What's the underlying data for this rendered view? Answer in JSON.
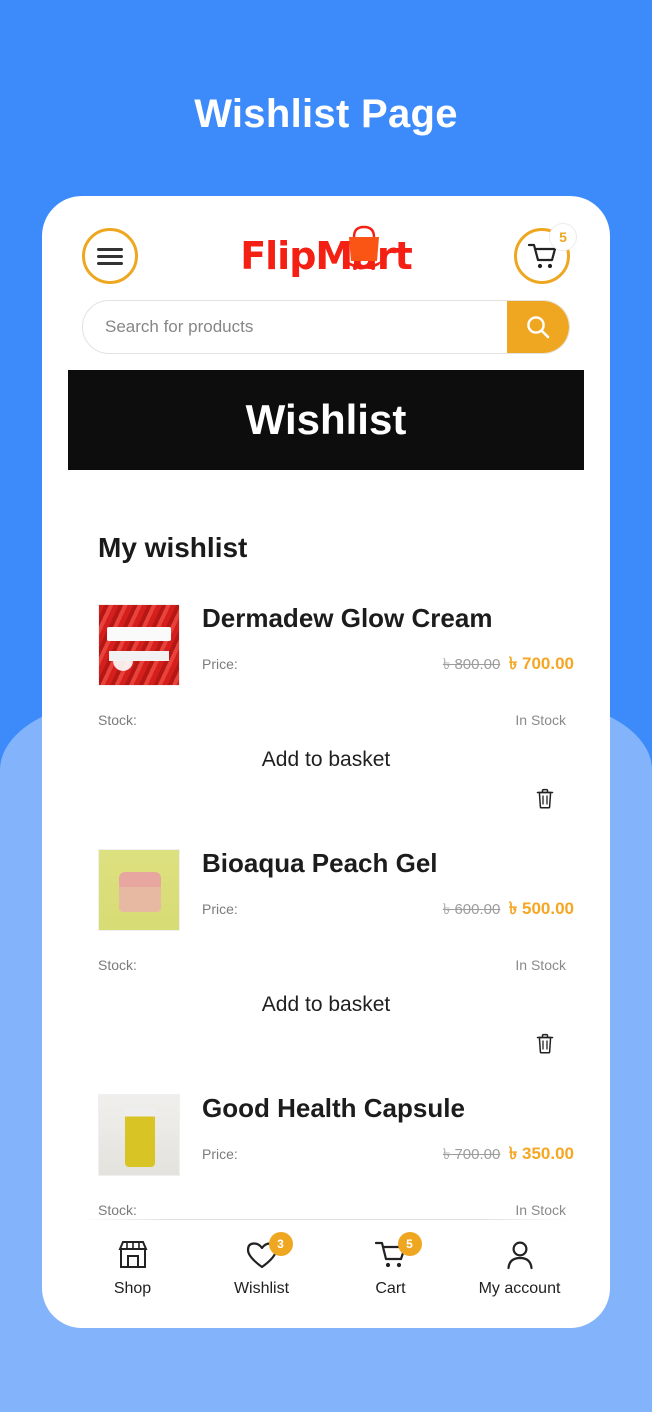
{
  "page": {
    "title": "Wishlist Page",
    "background_color": "#3d8bfa",
    "background_lower_color": "#83b4fb",
    "accent_color": "#efa721",
    "price_color": "#f5a623",
    "logo_color": "#f32013"
  },
  "header": {
    "menu_icon": "hamburger-icon",
    "logo_text": "FlipMart",
    "logo_icon": "shopping-bag-icon",
    "cart_icon": "cart-icon",
    "cart_badge": "5"
  },
  "search": {
    "placeholder": "Search for products",
    "value": "",
    "button_icon": "search-icon"
  },
  "banner": {
    "title": "Wishlist"
  },
  "main": {
    "section_title": "My wishlist",
    "price_label": "Price:",
    "stock_label": "Stock:",
    "add_to_basket_label": "Add to basket",
    "remove_icon": "trash-icon",
    "currency": "৳",
    "items": [
      {
        "name": "Dermadew Glow Cream",
        "old_price": "৳ 800.00",
        "new_price": "৳ 700.00",
        "stock": "In Stock",
        "thumb_alt": "dermadew-glow-cream-thumbnail"
      },
      {
        "name": "Bioaqua Peach Gel",
        "old_price": "৳ 600.00",
        "new_price": "৳ 500.00",
        "stock": "In Stock",
        "thumb_alt": "bioaqua-peach-gel-thumbnail"
      },
      {
        "name": "Good Health Capsule",
        "old_price": "৳ 700.00",
        "new_price": "৳ 350.00",
        "stock": "In Stock",
        "thumb_alt": "good-health-capsule-thumbnail"
      }
    ]
  },
  "bottom_nav": [
    {
      "label": "Shop",
      "icon": "store-icon",
      "badge": ""
    },
    {
      "label": "Wishlist",
      "icon": "heart-icon",
      "badge": "3"
    },
    {
      "label": "Cart",
      "icon": "cart-icon",
      "badge": "5"
    },
    {
      "label": "My account",
      "icon": "person-icon",
      "badge": ""
    }
  ]
}
